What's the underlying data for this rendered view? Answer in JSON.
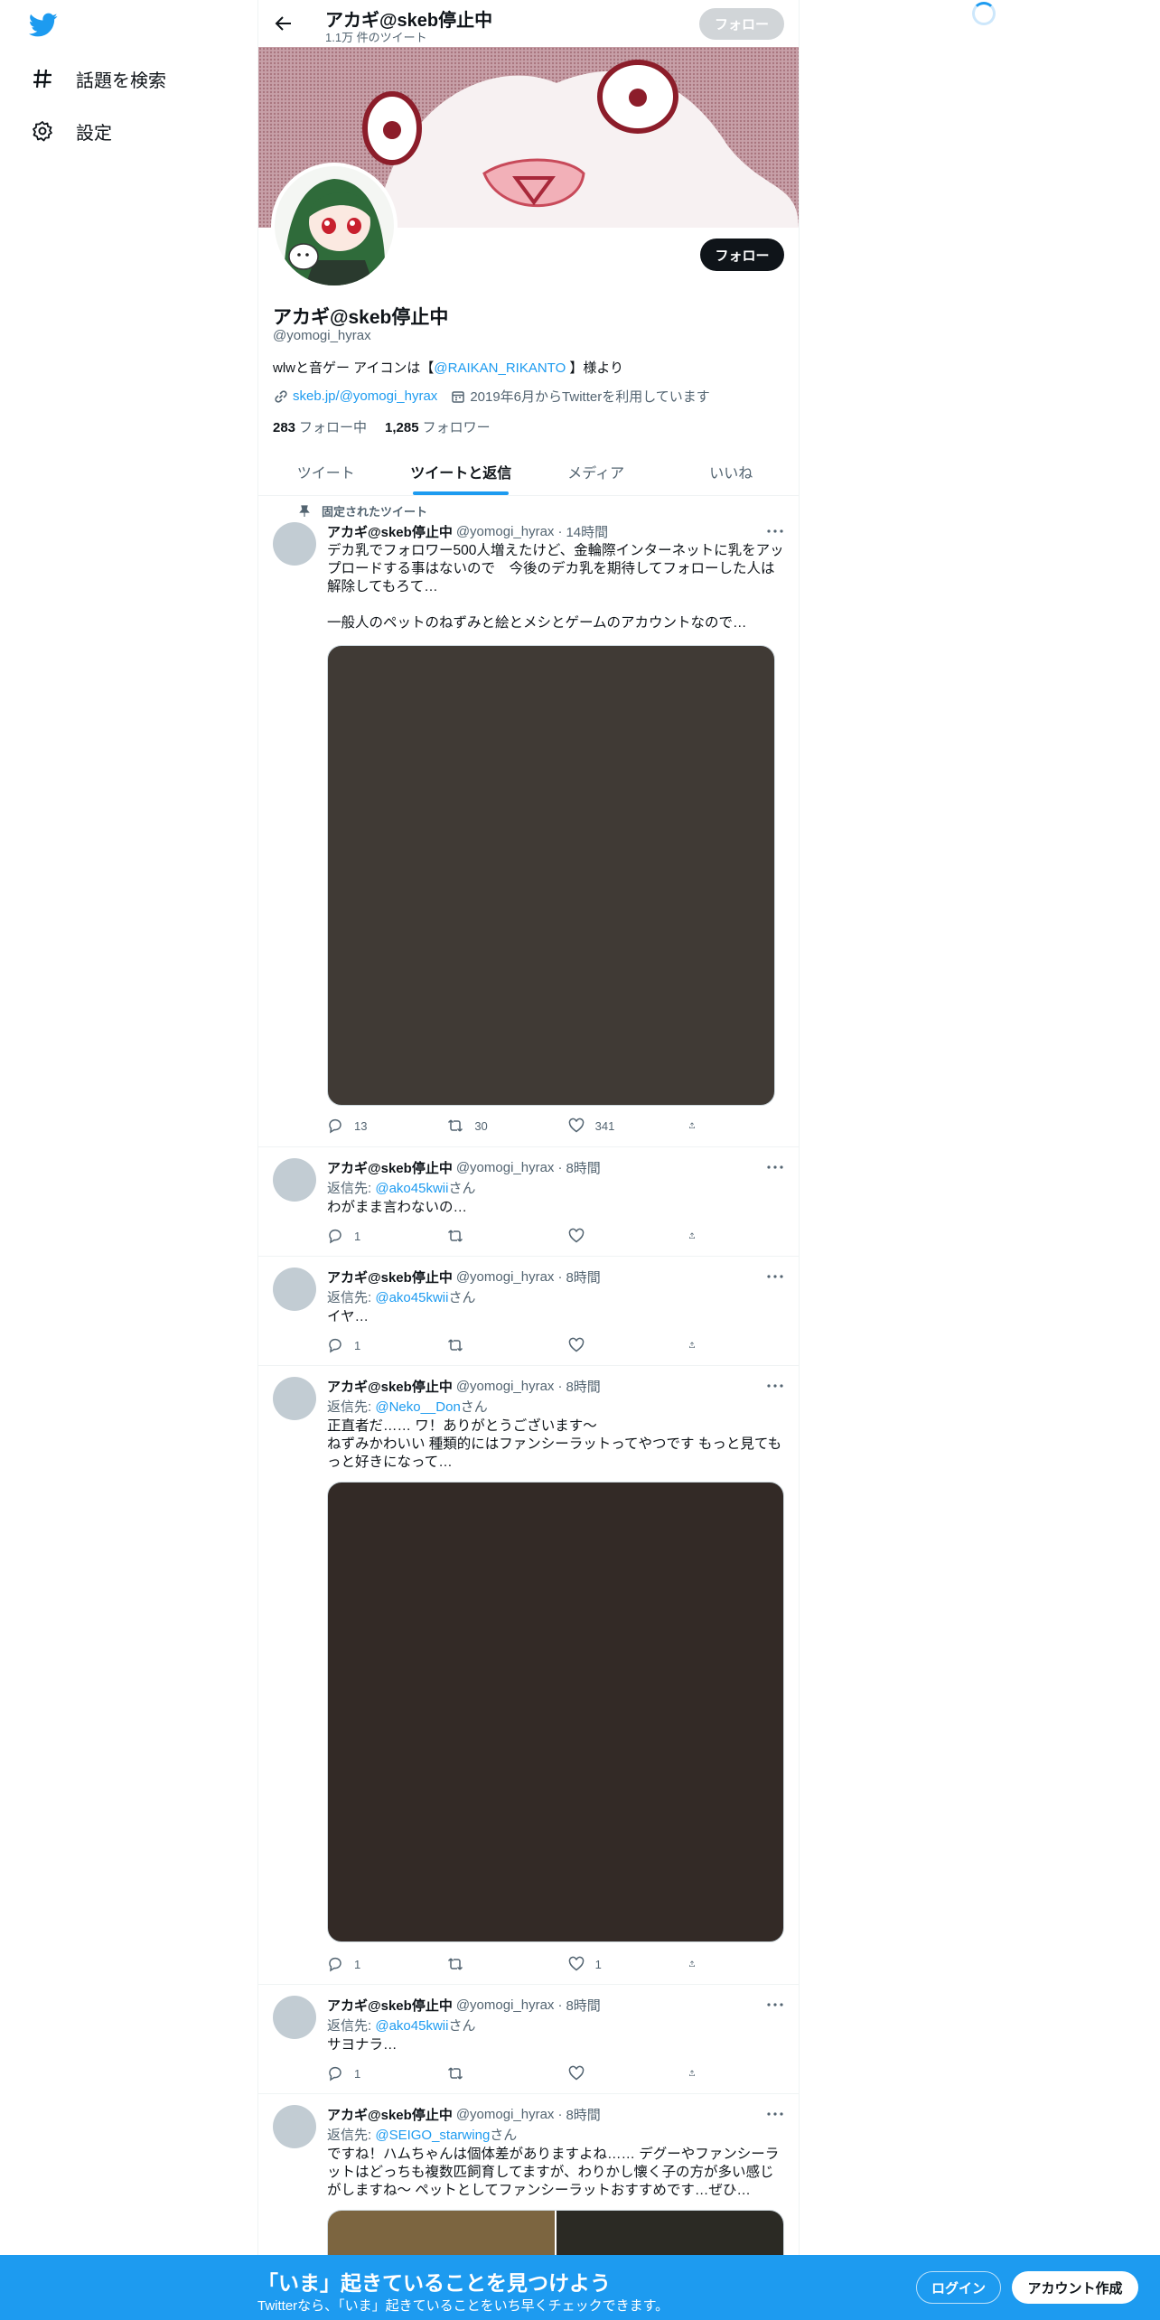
{
  "nav": {
    "items": [
      {
        "label": "話題を検索",
        "icon": "hashtag-icon"
      },
      {
        "label": "設定",
        "icon": "gear-icon"
      }
    ]
  },
  "header": {
    "name": "アカギ@skeb停止中",
    "tweet_count": "1.1万 件のツイート",
    "follow_label": "フォロー"
  },
  "profile": {
    "name": "アカギ@skeb停止中",
    "handle": "@yomogi_hyrax",
    "bio_prefix": "wlwと音ゲー アイコンは【",
    "bio_mention": "@RAIKAN_RIKANTO",
    "bio_suffix": " 】様より",
    "link": "skeb.jp/@yomogi_hyrax",
    "joined": "2019年6月からTwitterを利用しています",
    "following_count": "283",
    "following_label": "フォロー中",
    "followers_count": "1,285",
    "followers_label": "フォロワー",
    "follow_label": "フォロー"
  },
  "tabs": [
    {
      "label": "ツイート",
      "active": false
    },
    {
      "label": "ツイートと返信",
      "active": true
    },
    {
      "label": "メディア",
      "active": false
    },
    {
      "label": "いいね",
      "active": false
    }
  ],
  "pinned_label": "固定されたツイート",
  "reply_prefix": "返信先: ",
  "reply_suffix": "さん",
  "tweets": [
    {
      "name": "アカギ@skeb停止中",
      "handle": "@yomogi_hyrax",
      "time": "14時間",
      "text": "デカ乳でフォロワー500人増えたけど、金輪際インターネットに乳をアップロードする事はないので　今後のデカ乳を期待してフォローした人は解除してもろて…\n\n一般人のペットのねずみと絵とメシとゲームのアカウントなので…",
      "replies": "13",
      "retweets": "30",
      "likes": "341"
    },
    {
      "name": "アカギ@skeb停止中",
      "handle": "@yomogi_hyrax",
      "time": "8時間",
      "reply_to": "@ako45kwii",
      "text": "わがまま言わないの…",
      "replies": "1",
      "retweets": "",
      "likes": ""
    },
    {
      "name": "アカギ@skeb停止中",
      "handle": "@yomogi_hyrax",
      "time": "8時間",
      "reply_to": "@ako45kwii",
      "text": "イヤ…",
      "replies": "1",
      "retweets": "",
      "likes": ""
    },
    {
      "name": "アカギ@skeb停止中",
      "handle": "@yomogi_hyrax",
      "time": "8時間",
      "reply_to": "@Neko__Don",
      "text": "正直者だ…… ワ！ありがとうございます〜\nねずみかわいい 種類的にはファンシーラットってやつです もっと見てもっと好きになって…",
      "replies": "1",
      "retweets": "",
      "likes": "1"
    },
    {
      "name": "アカギ@skeb停止中",
      "handle": "@yomogi_hyrax",
      "time": "8時間",
      "reply_to": "@ako45kwii",
      "text": "サヨナラ…",
      "replies": "1",
      "retweets": "",
      "likes": ""
    },
    {
      "name": "アカギ@skeb停止中",
      "handle": "@yomogi_hyrax",
      "time": "8時間",
      "reply_to": "@SEIGO_starwing",
      "text": "ですね！ハムちゃんは個体差がありますよね…… デグーやファンシーラットはどっちも複数匹飼育してますが、わりかし懐く子の方が多い感じがしますね〜 ペットとしてファンシーラットおすすめです…ぜひ…",
      "replies": "",
      "retweets": "",
      "likes": ""
    }
  ],
  "bottom_bar": {
    "title": "「いま」起きていることを見つけよう",
    "subtitle": "Twitterなら、「いま」起きていることをいち早くチェックできます。",
    "login_label": "ログイン",
    "signup_label": "アカウント作成"
  }
}
